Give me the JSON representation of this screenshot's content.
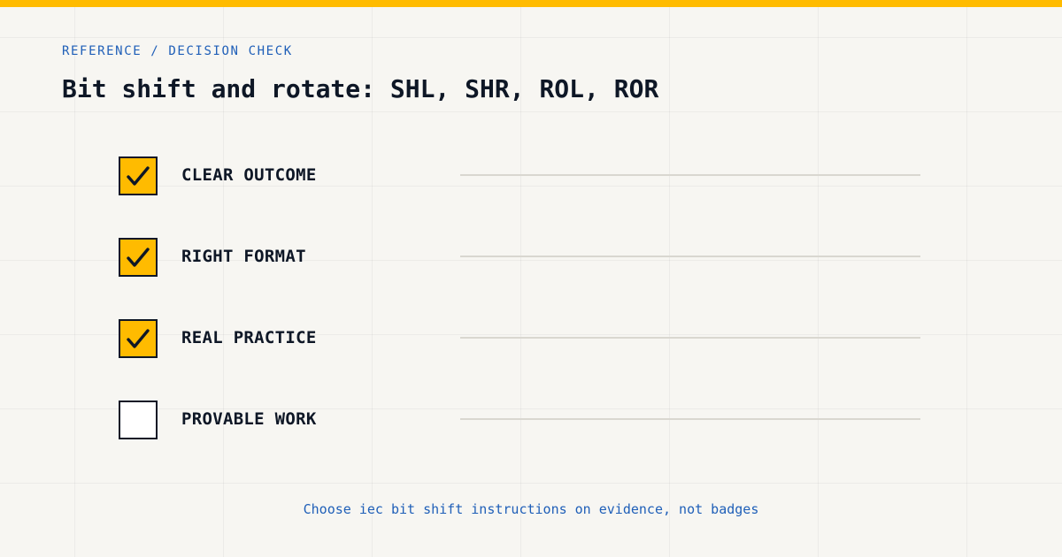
{
  "header": {
    "eyebrow": "REFERENCE / DECISION CHECK",
    "title": "Bit shift and rotate: SHL, SHR, ROL, ROR"
  },
  "checklist": [
    {
      "label": "CLEAR OUTCOME",
      "checked": true
    },
    {
      "label": "RIGHT FORMAT",
      "checked": true
    },
    {
      "label": "REAL PRACTICE",
      "checked": true
    },
    {
      "label": "PROVABLE WORK",
      "checked": false
    }
  ],
  "footer": {
    "note": "Choose iec bit shift instructions on evidence, not badges"
  },
  "colors": {
    "accent": "#ffbb00",
    "link": "#1f5fb8",
    "ink": "#0e1726",
    "background": "#f7f6f2"
  },
  "icons": {
    "checked": "checkmark-icon"
  }
}
